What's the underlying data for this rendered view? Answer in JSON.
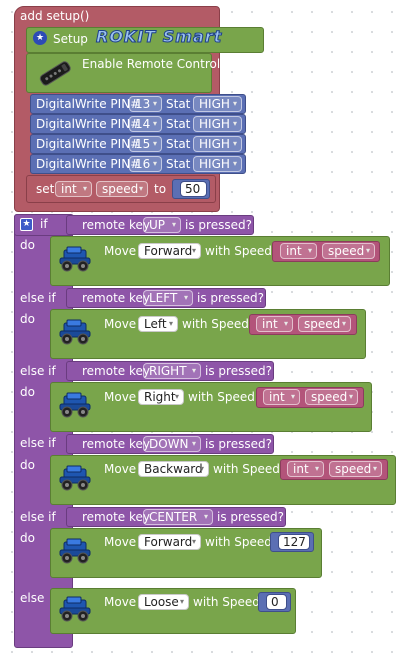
{
  "setup_hat": {
    "label": "add setup()"
  },
  "setup_block": {
    "label": "Setup",
    "brand": "ROKIT Smart",
    "star": "★"
  },
  "remote_enable": {
    "label": "Enable Remote Control"
  },
  "digital_writes": [
    {
      "prefix": "DigitalWrite PIN#",
      "pin": "13",
      "stat_label": "Stat",
      "stat": "HIGH"
    },
    {
      "prefix": "DigitalWrite PIN#",
      "pin": "14",
      "stat_label": "Stat",
      "stat": "HIGH"
    },
    {
      "prefix": "DigitalWrite PIN#",
      "pin": "15",
      "stat_label": "Stat",
      "stat": "HIGH"
    },
    {
      "prefix": "DigitalWrite PIN#",
      "pin": "16",
      "stat_label": "Stat",
      "stat": "HIGH"
    }
  ],
  "set_block": {
    "set": "set",
    "type": "int",
    "var": "speed",
    "to": "to",
    "value": "50"
  },
  "if_block": {
    "if_label": "if",
    "elseif_label": "else if",
    "do_label": "do",
    "else_label": "else",
    "remote_key": "remote key",
    "is_pressed": "is pressed?",
    "move": "Move",
    "with_speed": "with Speed"
  },
  "branches": [
    {
      "key": "UP",
      "direction": "Forward",
      "speed_type": "int",
      "speed_var": "speed"
    },
    {
      "key": "LEFT",
      "direction": "Left",
      "speed_type": "int",
      "speed_var": "speed"
    },
    {
      "key": "RIGHT",
      "direction": "Right",
      "speed_type": "int",
      "speed_var": "speed"
    },
    {
      "key": "DOWN",
      "direction": "Backward",
      "speed_type": "int",
      "speed_var": "speed"
    },
    {
      "key": "CENTER",
      "direction": "Forward",
      "speed_value": "127"
    }
  ],
  "else_branch": {
    "direction": "Loose",
    "speed_value": "0"
  },
  "dropdown_arrow": "▾",
  "colors": {
    "setup": "#b35b66",
    "green": "#79a54b",
    "blue": "#5b6fb4",
    "purple": "#8e55a8",
    "rose": "#b3547a"
  }
}
